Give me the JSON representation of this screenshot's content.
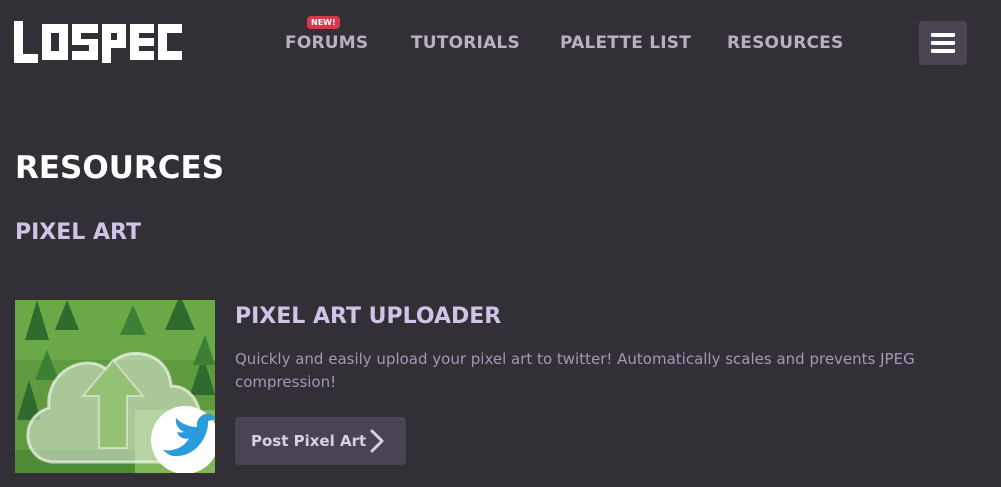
{
  "header": {
    "logo_text": "LOSPEC",
    "nav": [
      {
        "label": "FORUMS"
      },
      {
        "label": "TUTORIALS"
      },
      {
        "label": "PALETTE LIST"
      },
      {
        "label": "RESOURCES"
      }
    ],
    "badge": "NEW!",
    "menu_icon": "hamburger-icon"
  },
  "page": {
    "title": "RESOURCES",
    "section": "PIXEL ART"
  },
  "card": {
    "title": "PIXEL ART UPLOADER",
    "description": "Quickly and easily upload your pixel art to twitter! Automatically scales and prevents JPEG compression!",
    "button_label": "Post Pixel Art",
    "button_icon": "chevron-right-icon",
    "thumbnail_icons": [
      "cloud-upload-icon",
      "twitter-bird-icon"
    ]
  },
  "colors": {
    "background": "#332f36",
    "accent_lavender": "#d1c3e6",
    "nav_text": "#b9b0bf",
    "badge": "#d9384a",
    "button": "#4a4452"
  }
}
